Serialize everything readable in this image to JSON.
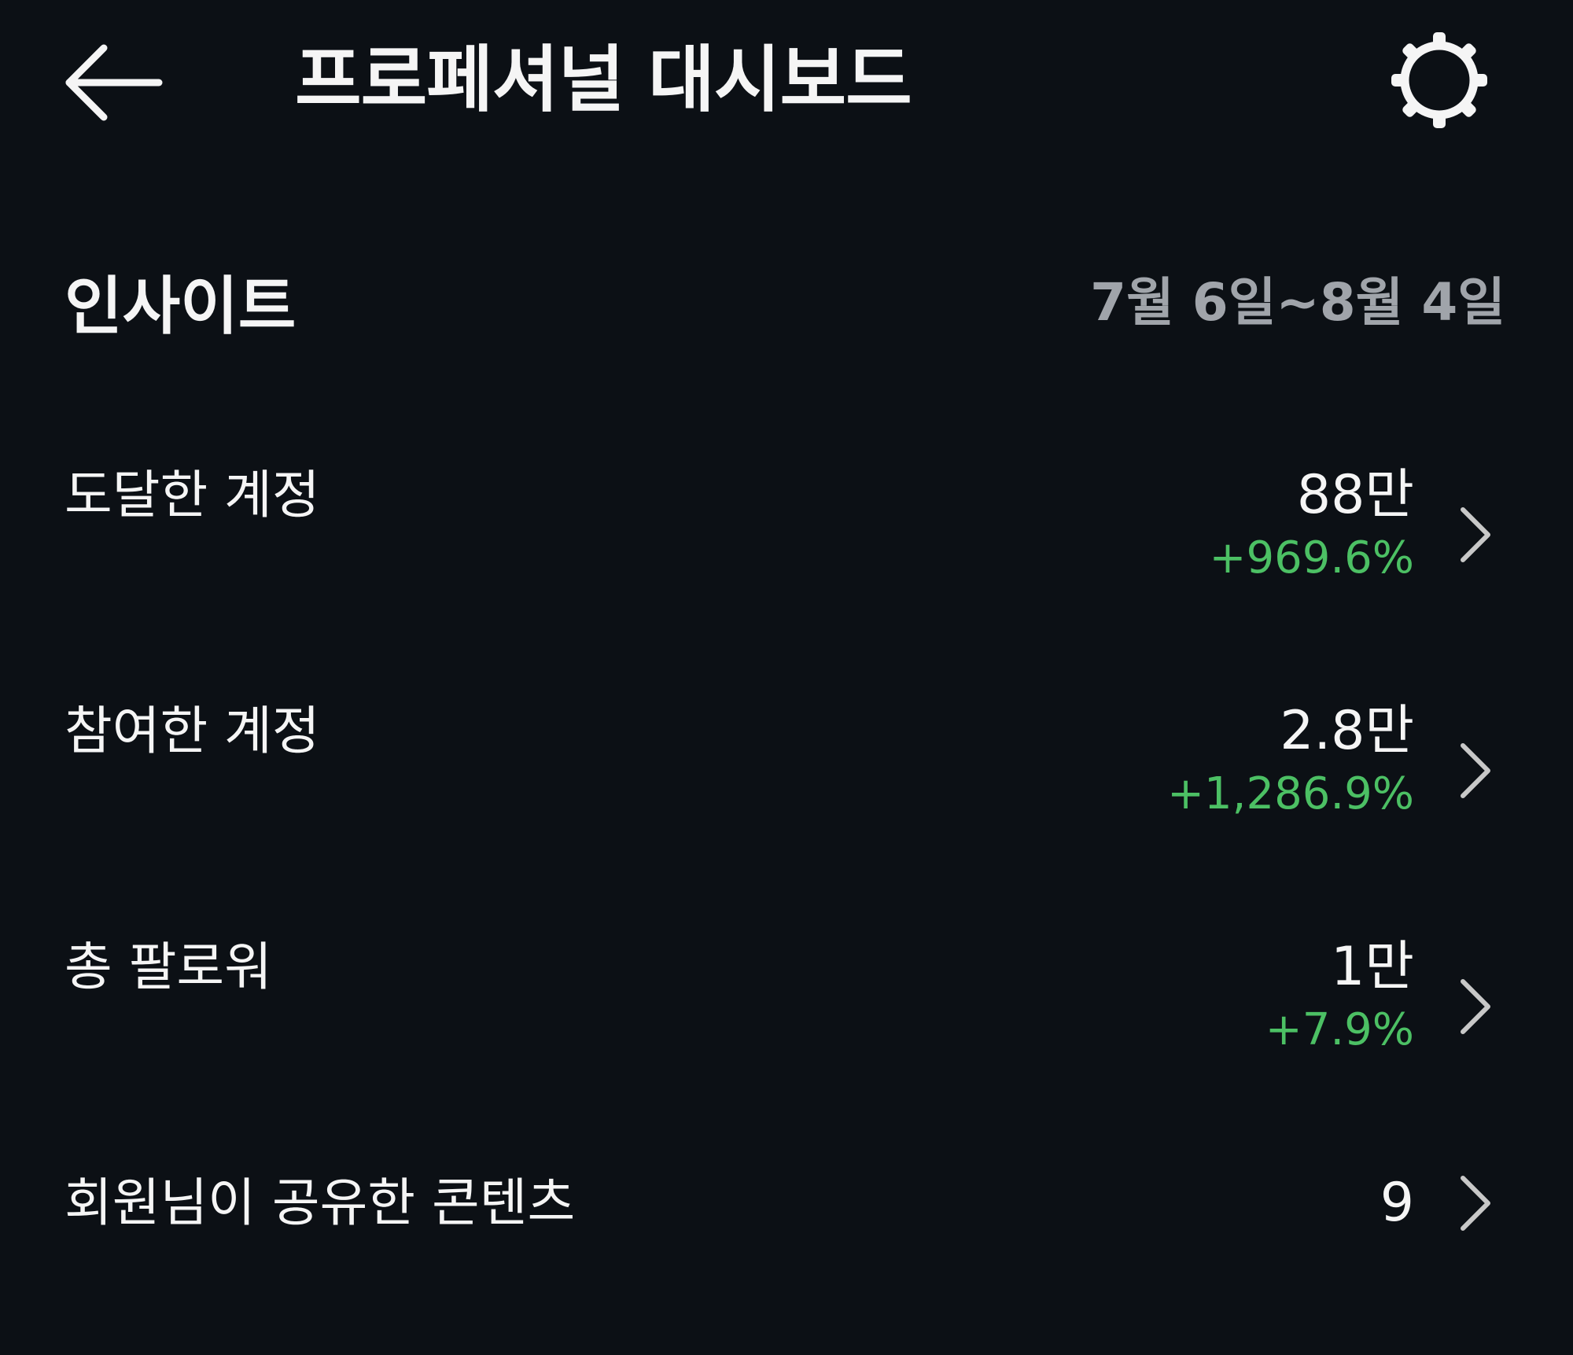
{
  "header": {
    "back_icon": "arrow-left-icon",
    "title": "프로페셔널 대시보드",
    "settings_icon": "gear-icon"
  },
  "insights": {
    "title": "인사이트",
    "date_range": "7월 6일~8월 4일"
  },
  "metrics": [
    {
      "label": "도달한 계정",
      "value": "88만",
      "change": "+969.6%"
    },
    {
      "label": "참여한 계정",
      "value": "2.8만",
      "change": "+1,286.9%"
    },
    {
      "label": "총 팔로워",
      "value": "1만",
      "change": "+7.9%"
    },
    {
      "label": "회원님이 공유한 콘텐츠",
      "value": "9",
      "change": ""
    }
  ],
  "colors": {
    "background": "#0c1015",
    "text_primary": "#f5f5f5",
    "text_secondary": "#a0a4aa",
    "positive_change": "#4cc064"
  }
}
